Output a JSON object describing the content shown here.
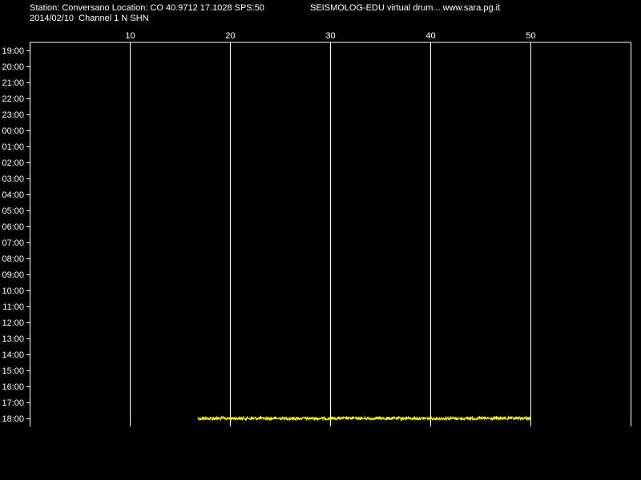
{
  "header": {
    "station_line": "Station: Conversano Location: CO 40.9712 17.1028 SPS:50",
    "app_line": "SEISMOLOG-EDU virtual drum... www.sara.pg.it",
    "date_channel_line": "2014/02/10  Channel 1 N SHN"
  },
  "colors": {
    "background": "#000000",
    "grid": "#ffffff",
    "text": "#ffffff",
    "trace": "#ffff00"
  },
  "chart_data": {
    "type": "line",
    "title": "",
    "xlabel": "",
    "ylabel": "",
    "grid": true,
    "x_ticks": [
      10,
      20,
      30,
      40,
      50
    ],
    "xlim": [
      0,
      60
    ],
    "y_ticks": [
      "19:00",
      "20:00",
      "21:00",
      "22:00",
      "23:00",
      "00:00",
      "01:00",
      "02:00",
      "03:00",
      "04:00",
      "05:00",
      "06:00",
      "07:00",
      "08:00",
      "09:00",
      "10:00",
      "11:00",
      "12:00",
      "13:00",
      "14:00",
      "15:00",
      "16:00",
      "17:00",
      "18:00"
    ],
    "series": [
      {
        "row": "18:00",
        "x_start": 16.8,
        "x_end": 50,
        "amplitude": 0.3
      }
    ]
  }
}
